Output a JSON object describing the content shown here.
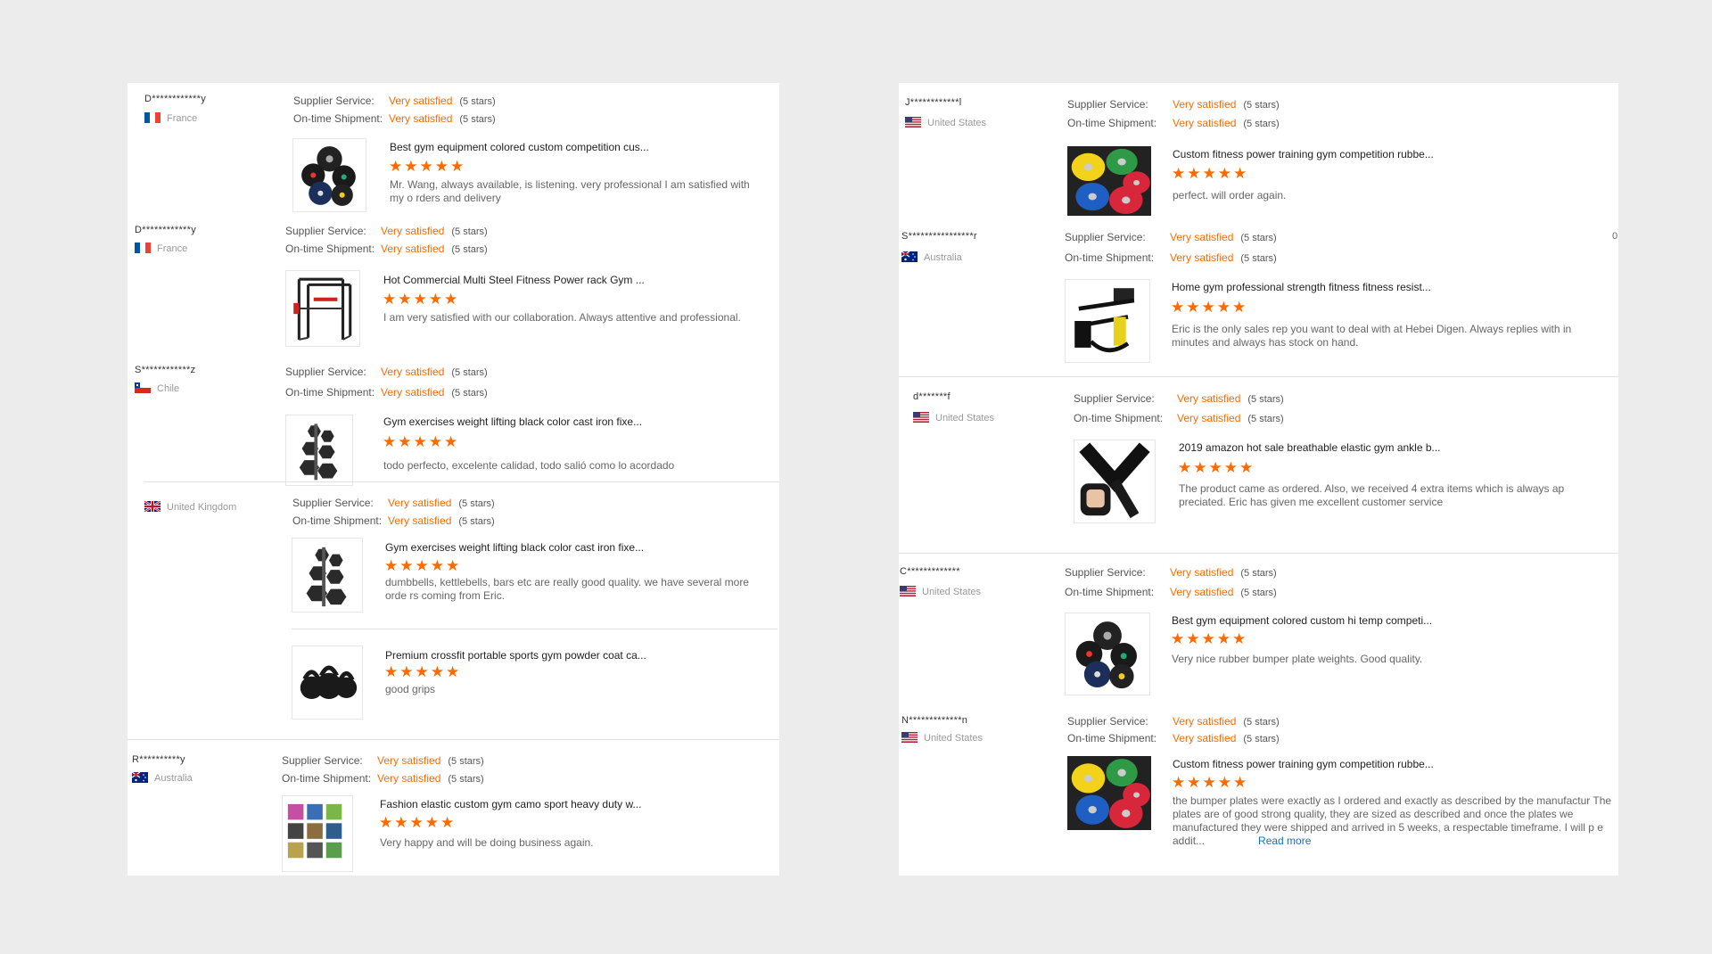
{
  "rating_labels": {
    "supplier": "Supplier Service:",
    "shipment": "On-time Shipment:",
    "value": "Very satisfied",
    "stars": "(5 stars)"
  },
  "stars_glyph": "★★★★★",
  "left": {
    "reviews": [
      {
        "user": "D************y",
        "country": "France",
        "flag": "france-flag",
        "products": [
          {
            "title": "Best gym equipment colored custom competition cus...",
            "comment": "Mr. Wang, always available, is listening. very professional I am satisfied with my o rders and delivery",
            "image": "colored-bumper-plates-image"
          }
        ]
      },
      {
        "user": "D************y",
        "country": "France",
        "flag": "france-flag",
        "products": [
          {
            "title": "Hot Commercial Multi Steel Fitness Power rack Gym ...",
            "comment": "I am very satisfied with our collaboration. Always attentive and professional.",
            "image": "power-rack-image"
          }
        ]
      },
      {
        "user": "S************z",
        "country": "Chile",
        "flag": "chile-flag",
        "products": [
          {
            "title": "Gym exercises weight lifting black color cast iron fixe...",
            "comment": "todo perfecto, excelente calidad, todo salió como lo acordado",
            "image": "hex-dumbbell-rack-image"
          }
        ]
      },
      {
        "user": "",
        "country": "United Kingdom",
        "flag": "uk-flag",
        "products": [
          {
            "title": "Gym exercises weight lifting black color cast iron fixe...",
            "comment": "dumbbells, kettlebells, bars etc are really good quality. we have several more orde rs coming from Eric.",
            "image": "hex-dumbbell-rack-image"
          },
          {
            "title": "Premium crossfit portable sports gym powder coat ca...",
            "comment": "good grips",
            "image": "kettlebells-image"
          }
        ]
      },
      {
        "user": "R**********y",
        "country": "Australia",
        "flag": "australia-flag",
        "products": [
          {
            "title": "Fashion elastic custom gym camo sport heavy duty w...",
            "comment": "Very happy and will be doing business again.",
            "image": "camo-resistance-bands-image"
          }
        ]
      }
    ]
  },
  "right": {
    "reviews": [
      {
        "user": "J************l",
        "country": "United States",
        "flag": "usa-flag",
        "products": [
          {
            "title": "Custom fitness power training gym competition rubbe...",
            "comment": "perfect. will order again.",
            "image": "competition-plates-image"
          }
        ]
      },
      {
        "user": "S****************r",
        "country": "Australia",
        "flag": "australia-flag",
        "edge_text": "0",
        "products": [
          {
            "title": "Home gym professional strength fitness fitness resist...",
            "comment": "Eric is the only sales rep you want to deal with at Hebei Digen. Always replies with in minutes and always has stock on hand.",
            "image": "suspension-trainer-image"
          }
        ]
      },
      {
        "user": "d*******f",
        "country": "United States",
        "flag": "usa-flag",
        "products": [
          {
            "title": "2019 amazon hot sale breathable elastic gym ankle b...",
            "comment": "The product came as ordered. Also, we received 4 extra items which is always ap preciated. Eric has given me excellent customer service",
            "image": "ankle-brace-image"
          }
        ]
      },
      {
        "user": "C*************",
        "country": "United States",
        "flag": "usa-flag",
        "products": [
          {
            "title": "Best gym equipment colored custom hi temp competi...",
            "comment": "Very nice rubber bumper plate weights. Good quality.",
            "image": "colored-bumper-plates-image"
          }
        ]
      },
      {
        "user": "N*************n",
        "country": "United States",
        "flag": "usa-flag",
        "products": [
          {
            "title": "Custom fitness power training gym competition rubbe...",
            "comment": "the bumper plates were exactly as I ordered and exactly as described by the manufactur The plates are of good strong quality, they are sized as described and once the plates we manufactured they were shipped and arrived in 5 weeks, a respectable timeframe. I will p e addit...",
            "read_more": "Read more",
            "image": "competition-plates-image"
          }
        ]
      }
    ]
  },
  "colors": {
    "accent": "#ff6a00",
    "link": "#1a6ebf",
    "background": "#ececec",
    "panel": "#ffffff"
  }
}
